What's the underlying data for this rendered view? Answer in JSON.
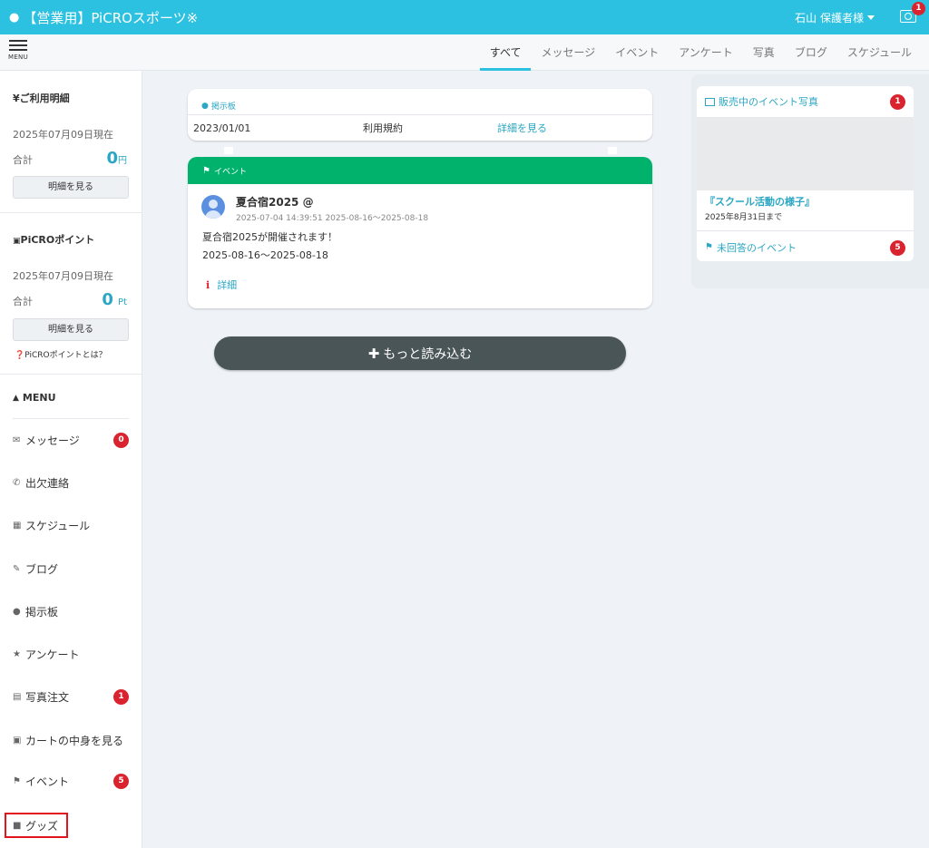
{
  "header": {
    "app_title": "【営業用】PiCROスポーツ※",
    "user_name": "石山 保護者様",
    "camera_badge": "1"
  },
  "subbar": {
    "menu_label": "MENU",
    "tabs": [
      "すべて",
      "メッセージ",
      "イベント",
      "アンケート",
      "写真",
      "ブログ",
      "スケジュール"
    ],
    "active_tab": "すべて"
  },
  "sidebar": {
    "usage": {
      "title": "¥ご利用明細",
      "date": "2025年07月09日現在",
      "sum_label": "合計",
      "sum_value": "0",
      "sum_unit": "円",
      "button": "明細を見る"
    },
    "points": {
      "title": "PiCROポイント",
      "date": "2025年07月09日現在",
      "sum_label": "合計",
      "sum_value": "0",
      "sum_unit": "Pt",
      "button": "明細を見る",
      "note": "PiCROポイントとは？"
    },
    "menu_title": "MENU",
    "items": [
      {
        "label": "メッセージ",
        "icon": "envelope-icon",
        "badge": "0"
      },
      {
        "label": "出欠連絡",
        "icon": "phone-icon",
        "badge": ""
      },
      {
        "label": "スケジュール",
        "icon": "calendar-icon",
        "badge": ""
      },
      {
        "label": "ブログ",
        "icon": "pencil-icon",
        "badge": ""
      },
      {
        "label": "掲示板",
        "icon": "comment-icon",
        "badge": ""
      },
      {
        "label": "アンケート",
        "icon": "star-icon",
        "badge": ""
      },
      {
        "label": "写真注文",
        "icon": "picture-icon",
        "badge": "1"
      },
      {
        "label": "カートの中身を見る",
        "icon": "cart-icon",
        "badge": ""
      },
      {
        "label": "イベント",
        "icon": "flag-icon",
        "badge": "5"
      },
      {
        "label": "グッズ",
        "icon": "box-icon",
        "badge": ""
      }
    ]
  },
  "bulletin": {
    "header": "掲示板",
    "date": "2023/01/01",
    "title": "利用規約",
    "link": "詳細を見る"
  },
  "event": {
    "header": "イベント",
    "title": "夏合宿2025 @",
    "meta": "2025-07-04 14:39:51 2025-08-16〜2025-08-18",
    "body_line1": "夏合宿2025が開催されます！",
    "body_line2": "2025-08-16〜2025-08-18",
    "detail": "詳細"
  },
  "load_more": "もっと読み込む",
  "right_panel": {
    "photo_sales": "販売中のイベント写真",
    "photo_badge": "1",
    "photo_title": "『スクール活動の様子』",
    "photo_until": "2025年8月31日まで",
    "unanswered": "未回答のイベント",
    "unanswered_badge": "5"
  },
  "colors": {
    "accent": "#2cc1e0",
    "link": "#2ba7c4",
    "event_green": "#00b26b",
    "badge_red": "#d9232e",
    "load_more_bg": "#4a5558"
  }
}
